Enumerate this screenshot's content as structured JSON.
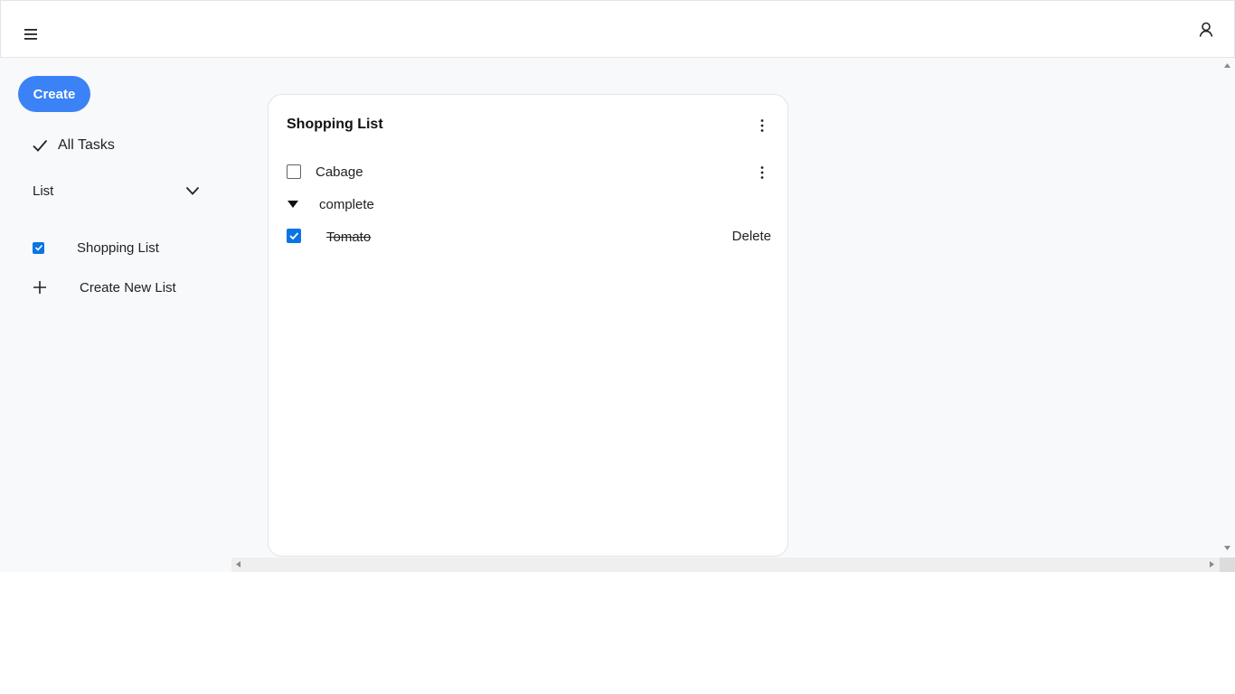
{
  "header": {
    "menu_icon": "hamburger-menu-icon",
    "user_icon": "user-account-icon"
  },
  "sidebar": {
    "create_label": "Create",
    "all_tasks_label": "All Tasks",
    "list_header_label": "List",
    "lists": [
      {
        "label": "Shopping List",
        "checked": true
      }
    ],
    "create_new_list_label": "Create New List"
  },
  "card": {
    "title": "Shopping List",
    "open_tasks": [
      {
        "label": "Cabage",
        "checked": false
      }
    ],
    "complete_section_label": "complete",
    "completed_tasks": [
      {
        "label": "Tomato",
        "checked": true,
        "action_label": "Delete"
      }
    ]
  },
  "colors": {
    "accent": "#3b82f6",
    "checkbox_checked": "#0b74e5",
    "app_background": "#f8f9fa"
  }
}
